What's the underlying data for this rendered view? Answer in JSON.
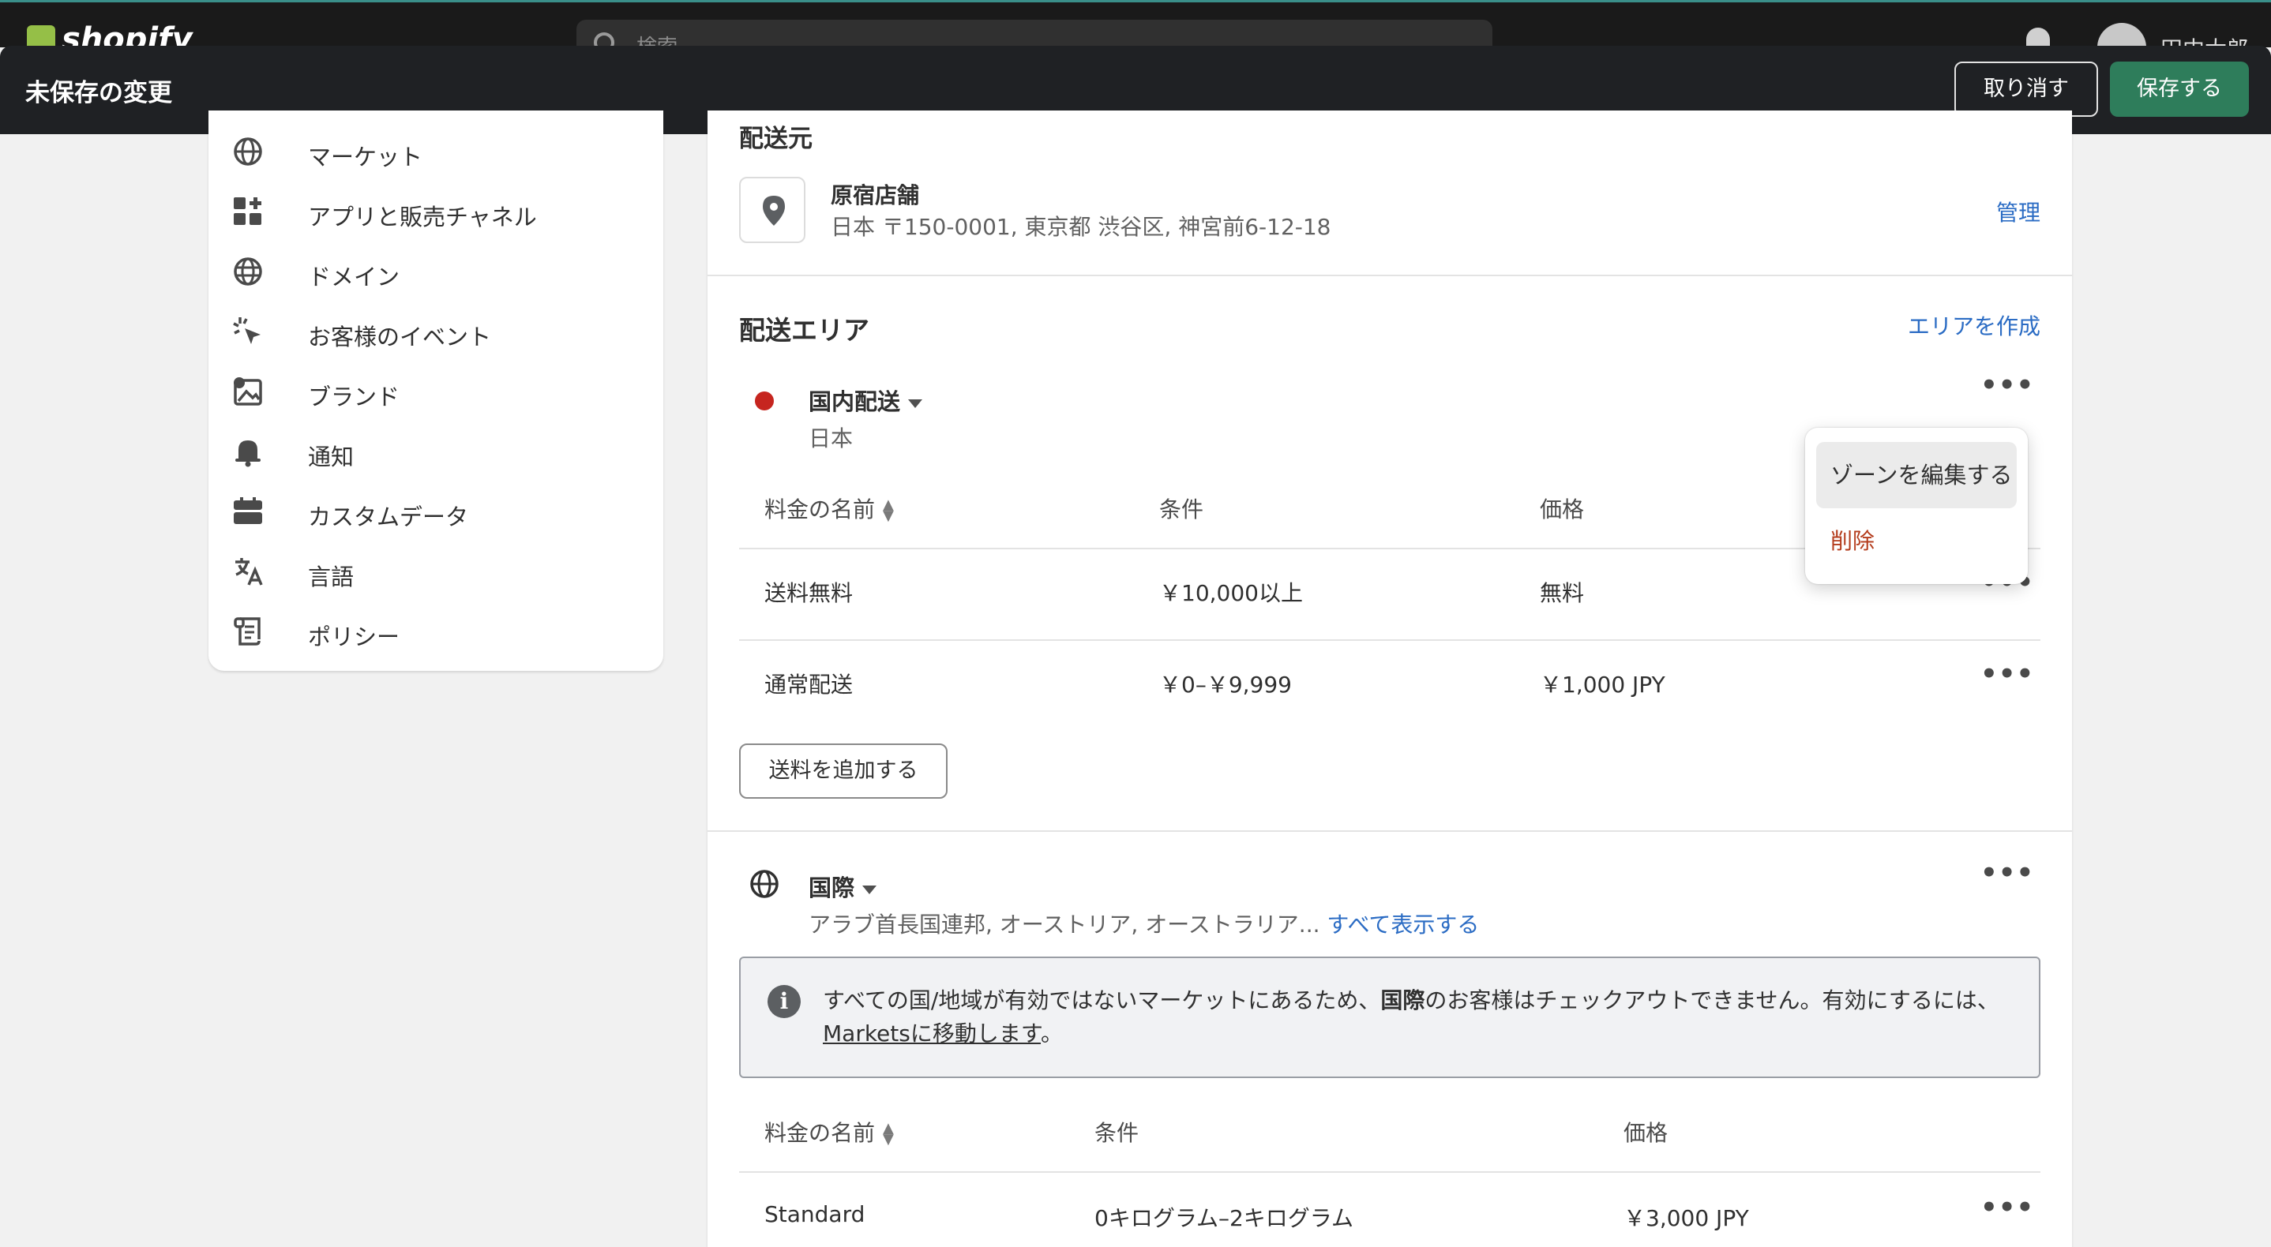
{
  "topbar": {
    "logo": "shopify",
    "search_placeholder": "検索",
    "user_name": "田中太郎"
  },
  "savebar": {
    "title": "未保存の変更",
    "discard_label": "取り消す",
    "save_label": "保存する"
  },
  "sidebar": {
    "items": [
      {
        "label": "マーケット",
        "icon": "globe-icon"
      },
      {
        "label": "アプリと販売チャネル",
        "icon": "apps-icon"
      },
      {
        "label": "ドメイン",
        "icon": "domain-globe-icon"
      },
      {
        "label": "お客様のイベント",
        "icon": "sparkle-cursor-icon"
      },
      {
        "label": "ブランド",
        "icon": "brand-image-icon"
      },
      {
        "label": "通知",
        "icon": "bell-icon"
      },
      {
        "label": "カスタムデータ",
        "icon": "custom-data-icon"
      },
      {
        "label": "言語",
        "icon": "translate-icon"
      },
      {
        "label": "ポリシー",
        "icon": "policy-icon"
      }
    ]
  },
  "origin": {
    "heading": "配送元",
    "name": "原宿店舗",
    "address": "日本 〒150-0001, 東京都 渋谷区, 神宮前6-12-18",
    "manage_label": "管理"
  },
  "zones": {
    "heading": "配送エリア",
    "create_label": "エリアを作成",
    "domestic": {
      "name": "国内配送",
      "countries": "日本",
      "columns": [
        "料金の名前",
        "条件",
        "価格"
      ],
      "rows": [
        {
          "name": "送料無料",
          "condition": "￥10,000以上",
          "price": "無料"
        },
        {
          "name": "通常配送",
          "condition": "￥0–￥9,999",
          "price": "￥1,000 JPY"
        }
      ],
      "add_rate_label": "送料を追加する"
    },
    "international": {
      "name": "国際",
      "countries": "アラブ首長国連邦, オーストリア, オーストラリア...",
      "show_all_label": "すべて表示する",
      "banner_line1_before": "すべての国/地域が有効ではないマーケットにあるため、",
      "banner_line1_bold": "国際",
      "banner_line1_after": "のお客様はチェックアウトできません。有効にするには、",
      "banner_link": "Marketsに移動します",
      "banner_end": "。",
      "columns": [
        "料金の名前",
        "条件",
        "価格"
      ],
      "rows": [
        {
          "name": "Standard",
          "condition": "0キログラム–2キログラム",
          "price": "￥3,000 JPY"
        }
      ]
    }
  },
  "popover": {
    "edit_label": "ゾーンを編集する",
    "delete_label": "削除"
  },
  "colors": {
    "save_button": "#2e7d5b",
    "link": "#2b6cc4",
    "delete": "#b43c1c",
    "zone_dot": "#c6251f"
  }
}
